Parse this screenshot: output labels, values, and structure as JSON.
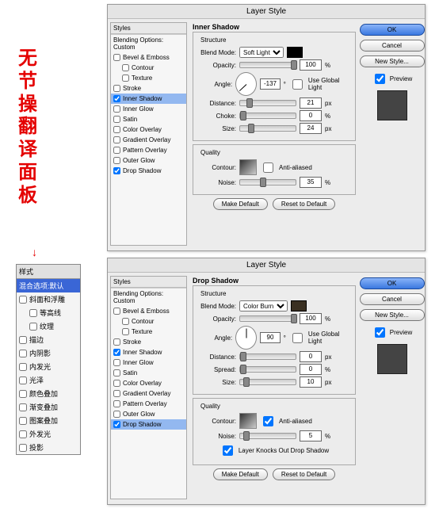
{
  "redLabel": "无节操翻译面板",
  "cnPanel": {
    "header": "样式",
    "highlight": "混合选项:默认",
    "items": [
      "斜面和浮雕",
      "等高线",
      "纹理",
      "描边",
      "内阴影",
      "内发光",
      "光泽",
      "颜色叠加",
      "渐变叠加",
      "图案叠加",
      "外发光",
      "投影"
    ]
  },
  "dialogTitle": "Layer Style",
  "stylesHeader": "Styles",
  "stylesSub": "Blending Options: Custom",
  "effects": {
    "bevel": "Bevel & Emboss",
    "contour": "Contour",
    "texture": "Texture",
    "stroke": "Stroke",
    "innerShadow": "Inner Shadow",
    "innerGlow": "Inner Glow",
    "satin": "Satin",
    "colorOverlay": "Color Overlay",
    "gradientOverlay": "Gradient Overlay",
    "patternOverlay": "Pattern Overlay",
    "outerGlow": "Outer Glow",
    "dropShadow": "Drop Shadow"
  },
  "structLabel": "Structure",
  "qualityLabel": "Quality",
  "labels": {
    "blendMode": "Blend Mode:",
    "opacity": "Opacity:",
    "angle": "Angle:",
    "useGlobal": "Use Global Light",
    "distance": "Distance:",
    "choke": "Choke:",
    "spread": "Spread:",
    "size": "Size:",
    "contour": "Contour:",
    "antiAliased": "Anti-aliased",
    "noise": "Noise:",
    "layerKnocks": "Layer Knocks Out Drop Shadow",
    "px": "px",
    "pct": "%",
    "deg": "°"
  },
  "top": {
    "effectTitle": "Inner Shadow",
    "blendMode": "Soft Light",
    "swatch": "#000000",
    "opacity": "100",
    "angle": "-137",
    "useGlobal": false,
    "distance": "21",
    "choke": "0",
    "size": "24",
    "antiAliased": false,
    "noise": "35"
  },
  "bottom": {
    "effectTitle": "Drop Shadow",
    "blendMode": "Color Burn",
    "swatch": "#3a3022",
    "opacity": "100",
    "angle": "90",
    "useGlobal": false,
    "distance": "0",
    "spread": "0",
    "size": "10",
    "antiAliased": true,
    "noise": "5",
    "layerKnocks": true
  },
  "buttons": {
    "ok": "OK",
    "cancel": "Cancel",
    "newStyle": "New Style...",
    "preview": "Preview",
    "makeDefault": "Make Default",
    "resetDefault": "Reset to Default"
  }
}
